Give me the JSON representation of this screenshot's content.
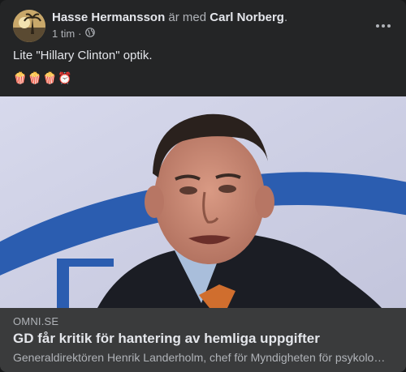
{
  "post": {
    "author": "Hasse Hermansson",
    "with_text": " är med ",
    "tagged": "Carl Norberg",
    "period": ".",
    "time": "1 tim",
    "dot": " · ",
    "text": "Lite \"Hillary Clinton\" optik.",
    "emojis": "🍿🍿🍿⏰"
  },
  "link": {
    "domain": "OMNI.SE",
    "title": "GD får kritik för hantering av hemliga uppgifter",
    "description": "Generaldirektören Henrik Landerholm, chef för Myndigheten för psykologiskt försvar"
  },
  "icons": {
    "privacy": "globe-icon",
    "menu": "more-options-icon"
  },
  "colors": {
    "card_bg": "#242526",
    "link_bg": "#3a3b3c",
    "text_primary": "#e4e6eb",
    "text_secondary": "#b0b3b8"
  }
}
